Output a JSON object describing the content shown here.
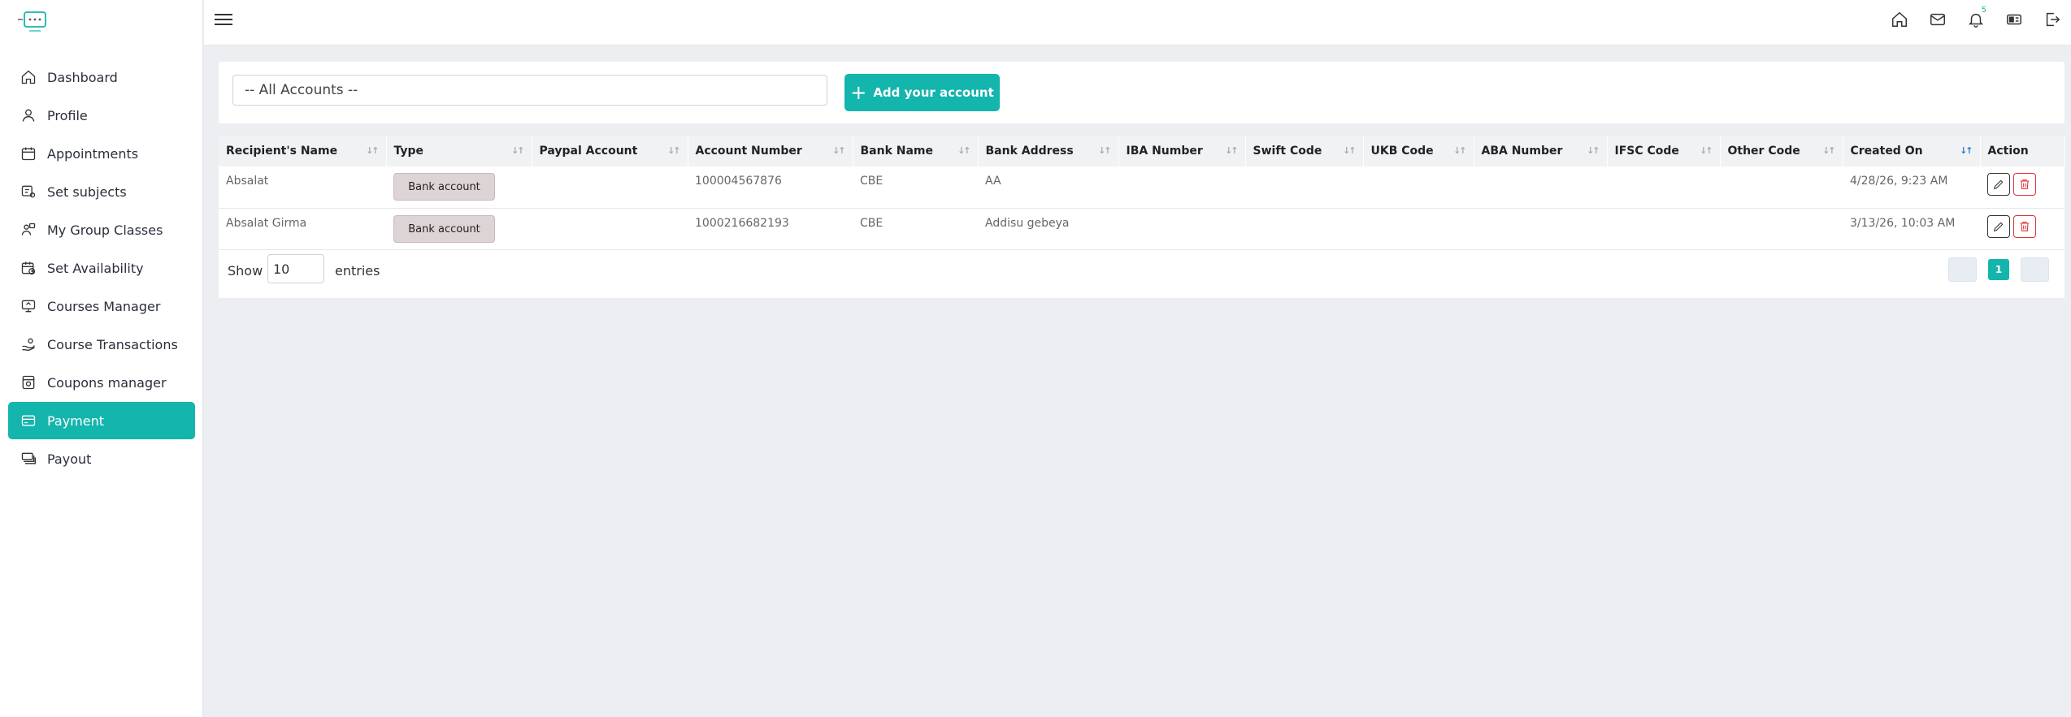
{
  "sidebar": {
    "items": [
      {
        "label": "Dashboard",
        "icon": "home-icon"
      },
      {
        "label": "Profile",
        "icon": "user-icon"
      },
      {
        "label": "Appointments",
        "icon": "calendar-icon"
      },
      {
        "label": "Set subjects",
        "icon": "subjects-icon"
      },
      {
        "label": "My Group Classes",
        "icon": "group-icon"
      },
      {
        "label": "Set Availability",
        "icon": "calendar-clock-icon"
      },
      {
        "label": "Courses Manager",
        "icon": "monitor-icon"
      },
      {
        "label": "Course Transactions",
        "icon": "hand-coin-icon"
      },
      {
        "label": "Coupons manager",
        "icon": "coupon-icon"
      },
      {
        "label": "Payment",
        "icon": "card-icon",
        "active": true
      },
      {
        "label": "Payout",
        "icon": "money-stack-icon"
      }
    ]
  },
  "topbar": {
    "notification_count": "5",
    "icons": [
      "home-icon",
      "mail-icon",
      "bell-icon",
      "id-card-icon",
      "logout-icon"
    ]
  },
  "accounts": {
    "select_value": "-- All Accounts --",
    "add_label": "Add your account"
  },
  "table": {
    "headers": [
      "Recipient's Name",
      "Type",
      "Paypal Account",
      "Account Number",
      "Bank Name",
      "Bank Address",
      "IBA Number",
      "Swift Code",
      "UKB Code",
      "ABA Number",
      "IFSC Code",
      "Other Code",
      "Created On",
      "Action"
    ],
    "rows": [
      {
        "name": "Absalat",
        "type": "Bank account",
        "paypal": "",
        "account_number": "100004567876",
        "bank_name": "CBE",
        "bank_address": "AA",
        "iba": "",
        "swift": "",
        "ukb": "",
        "aba": "",
        "ifsc": "",
        "other": "",
        "created_on": "4/28/26, 9:23 AM"
      },
      {
        "name": "Absalat Girma",
        "type": "Bank account",
        "paypal": "",
        "account_number": "1000216682193",
        "bank_name": "CBE",
        "bank_address": "Addisu gebeya",
        "iba": "",
        "swift": "",
        "ukb": "",
        "aba": "",
        "ifsc": "",
        "other": "",
        "created_on": "3/13/26, 10:03 AM"
      }
    ]
  },
  "footer": {
    "show_label": "Show",
    "page_size": "10",
    "entries_label": "entries",
    "current_page": "1"
  },
  "colors": {
    "accent": "#13b5ad",
    "background": "#eceef2"
  }
}
